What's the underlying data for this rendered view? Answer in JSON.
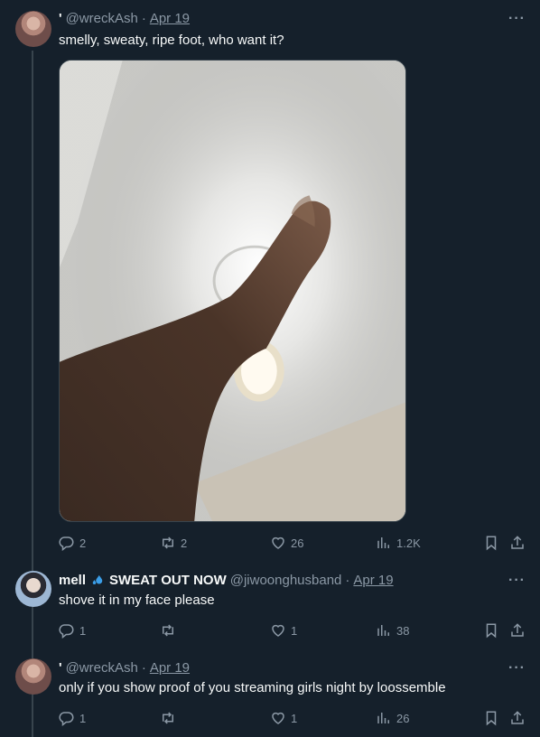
{
  "tweets": [
    {
      "name": "'",
      "handle": "@wreckAsh",
      "date": "Apr 19",
      "text": "smelly, sweaty, ripe foot, who want it?",
      "stats": {
        "replies": "2",
        "retweets": "2",
        "likes": "26",
        "views": "1.2K"
      }
    },
    {
      "name": "mell",
      "badge_text": "SWEAT OUT NOW",
      "handle": "@jiwoonghusband",
      "date": "Apr 19",
      "text": "shove it in my face please",
      "stats": {
        "replies": "1",
        "retweets": "",
        "likes": "1",
        "views": "38"
      }
    },
    {
      "name": "'",
      "handle": "@wreckAsh",
      "date": "Apr 19",
      "text": "only if you show proof of you streaming girls night by loossemble",
      "stats": {
        "replies": "1",
        "retweets": "",
        "likes": "1",
        "views": "26"
      }
    }
  ],
  "more_glyph": "···",
  "separator": "·",
  "icons": [
    "reply-icon",
    "retweet-icon",
    "like-icon",
    "views-icon",
    "bookmark-icon",
    "share-icon",
    "sweat-drops-icon"
  ],
  "colors": {
    "background": "#15202b",
    "muted": "#8b98a5",
    "text": "#f7f9f9",
    "border": "#38444d",
    "sweat": "#3b9ee8"
  }
}
